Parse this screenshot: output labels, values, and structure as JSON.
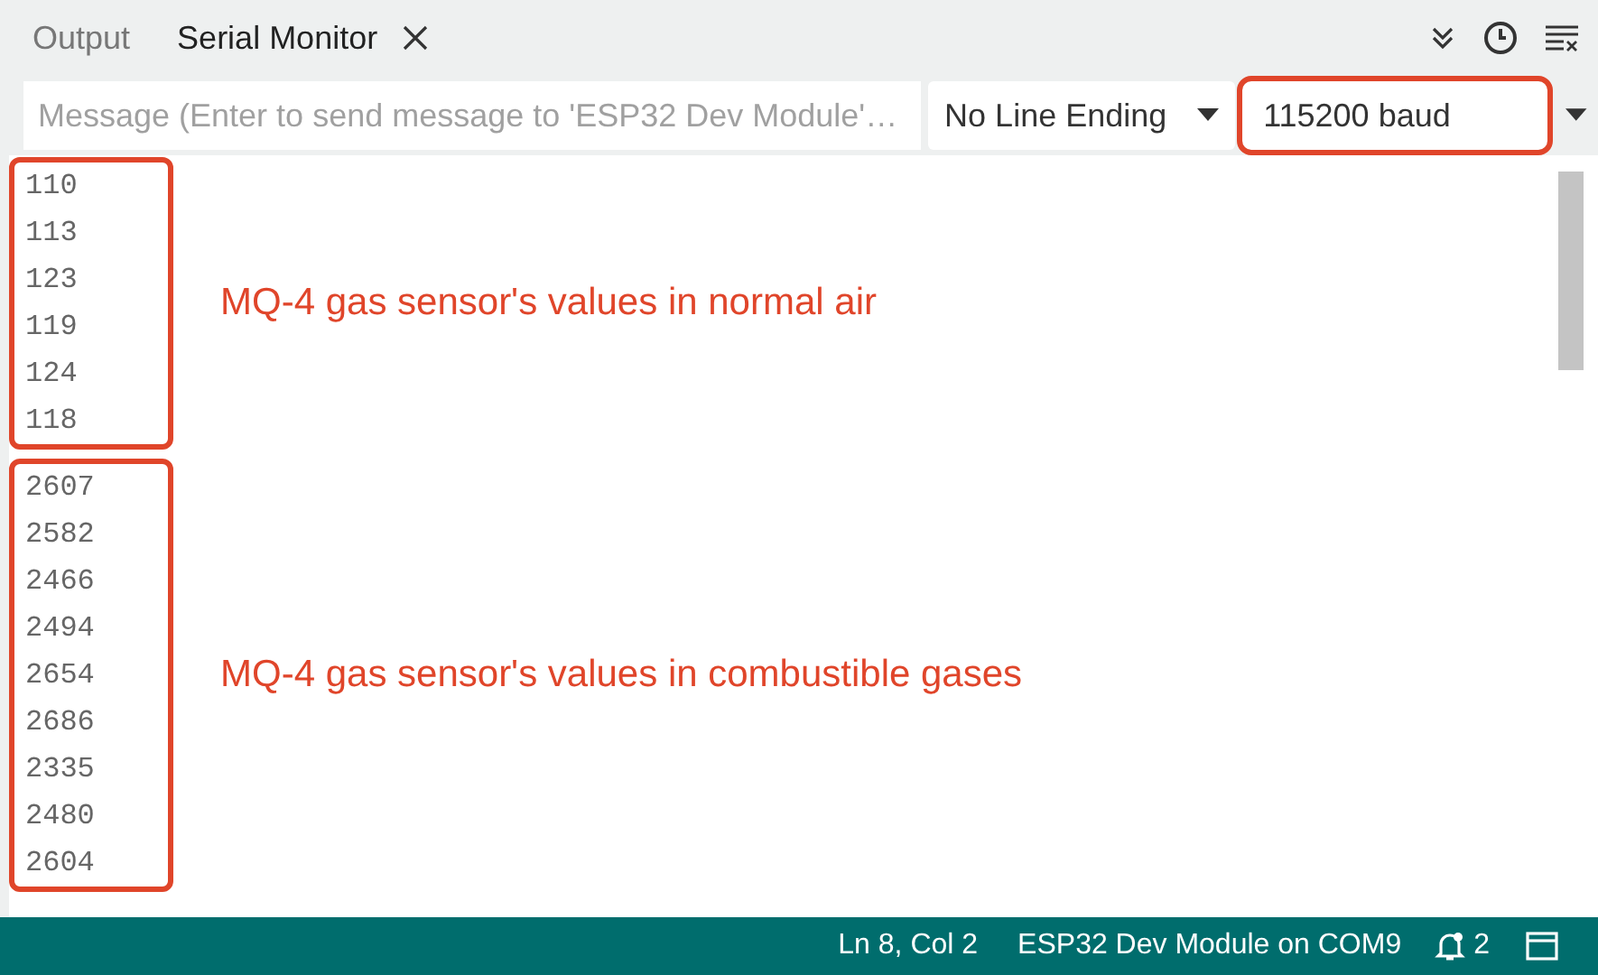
{
  "tabs": [
    {
      "label": "Output",
      "selected": false,
      "closable": false
    },
    {
      "label": "Serial Monitor",
      "selected": true,
      "closable": true
    }
  ],
  "message_field": {
    "placeholder": "Message (Enter to send message to 'ESP32 Dev Module'…"
  },
  "line_ending": {
    "value": "No Line Ending",
    "highlighted": false
  },
  "baud_rate": {
    "value": "115200 baud",
    "highlighted": true
  },
  "output_groups": [
    {
      "lines": [
        "110",
        "113",
        "123",
        "119",
        "124",
        "118"
      ],
      "note": "MQ-4 gas sensor's values in normal air"
    },
    {
      "lines": [
        "2607",
        "2582",
        "2466",
        "2494",
        "2654",
        "2686",
        "2335",
        "2480",
        "2604"
      ],
      "note": "MQ-4 gas sensor's values in combustible gases"
    }
  ],
  "status_bar": {
    "position": "Ln 8, Col 2",
    "board": "ESP32 Dev Module on COM9",
    "notifications": "2"
  }
}
